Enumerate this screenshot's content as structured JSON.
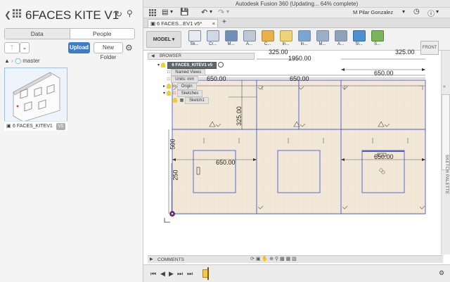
{
  "window": {
    "title": "Autodesk Fusion 360  (Updating... 64% complete)"
  },
  "data_panel": {
    "project_title": "6FACES KITE V1",
    "tabs": [
      {
        "label": "Data",
        "active": true
      },
      {
        "label": "People",
        "active": false
      }
    ],
    "upload_label": "Upload",
    "new_folder_label": "New Folder",
    "branch": "master",
    "item": {
      "name": "6 FACES_KITEV1",
      "version": "V5"
    }
  },
  "app_bar": {
    "user": "M Pilar Gonzalez"
  },
  "document_tab": {
    "label": "6 FACES...EV1 v5*"
  },
  "toolbar": {
    "mode_label": "MODEL",
    "tools": [
      "Sk...",
      "Cr...",
      "M...",
      "A...",
      "C...",
      "In...",
      "In...",
      "M...",
      "A...",
      "Sl...",
      "S..."
    ]
  },
  "browser": {
    "header": "BROWSER",
    "root": "6 FACES_KITEV1 v5",
    "items": [
      "Named Views",
      "Units: mm",
      "Origin",
      "Sketches",
      "Sketch1"
    ]
  },
  "viewcube": {
    "label": "FRONT"
  },
  "sketch_palette_label": "SKETCH PALETTE",
  "dimensions": [
    "325.00",
    "1950.00",
    "325.00",
    "650.00",
    "650.00",
    "650.00",
    "325.00",
    "500",
    "650.00",
    "650.00",
    "250"
  ],
  "comments_label": "COMMENTS",
  "colors": {
    "accent": "#3c7dc4",
    "sketch_line": "#4a5fd0",
    "sketch_fill": "#f3e8d8",
    "grid": "#e8ddd0"
  }
}
